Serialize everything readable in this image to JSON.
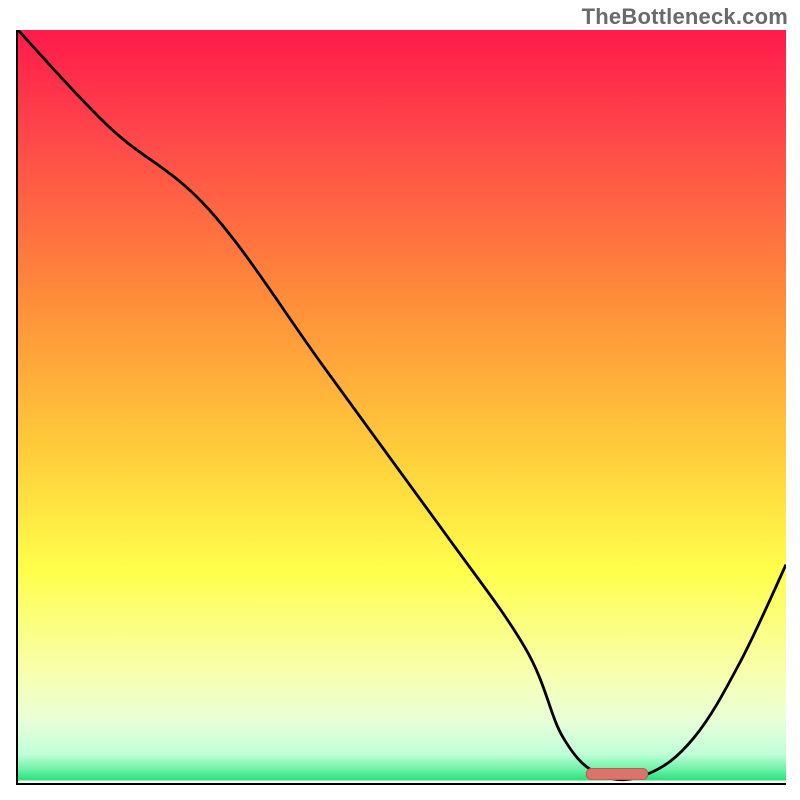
{
  "watermark": "TheBottleneck.com",
  "colors": {
    "axis": "#000000",
    "line": "#000000",
    "marker_fill": "#d9746a",
    "marker_stroke": "#c25a50",
    "gradient_stops": [
      {
        "offset": 0.0,
        "color": "#ff1a4b"
      },
      {
        "offset": 0.15,
        "color": "#ff4a4a"
      },
      {
        "offset": 0.35,
        "color": "#ff8a3a"
      },
      {
        "offset": 0.55,
        "color": "#ffc93a"
      },
      {
        "offset": 0.72,
        "color": "#ffff4a"
      },
      {
        "offset": 0.86,
        "color": "#f7ffb0"
      },
      {
        "offset": 0.92,
        "color": "#e8ffd8"
      },
      {
        "offset": 0.965,
        "color": "#bfffd8"
      },
      {
        "offset": 0.985,
        "color": "#6ef2a8"
      },
      {
        "offset": 1.0,
        "color": "#26e07a"
      }
    ]
  },
  "chart_data": {
    "type": "line",
    "title": "",
    "xlabel": "",
    "ylabel": "",
    "xlim": [
      0,
      100
    ],
    "ylim": [
      0,
      100
    ],
    "series": [
      {
        "name": "curve",
        "x": [
          0,
          12,
          25,
          40,
          55,
          66,
          71,
          76,
          82,
          88,
          94,
          100
        ],
        "values": [
          100,
          87,
          76,
          55,
          34,
          18,
          6,
          1,
          1.2,
          6,
          16,
          29
        ]
      }
    ],
    "marker": {
      "x_start": 74,
      "x_end": 82,
      "y": 1.2
    },
    "annotations": []
  }
}
